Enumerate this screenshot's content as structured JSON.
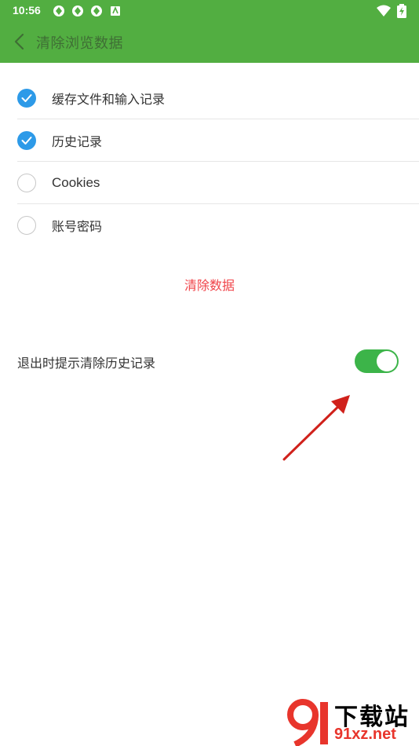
{
  "status_bar": {
    "time": "10:56"
  },
  "header": {
    "title": "清除浏览数据",
    "back_icon": "chevron-left-icon"
  },
  "options": [
    {
      "label": "缓存文件和输入记录",
      "checked": true
    },
    {
      "label": "历史记录",
      "checked": true
    },
    {
      "label": "Cookies",
      "checked": false
    },
    {
      "label": "账号密码",
      "checked": false
    }
  ],
  "clear_button": {
    "label": "清除数据"
  },
  "setting": {
    "label": "退出时提示清除历史记录",
    "enabled": true
  },
  "watermark": {
    "top_text": "下载站",
    "bottom_text": "91xz.net"
  },
  "colors": {
    "header_bg": "#52ae41",
    "checkbox_on": "#2d9ae8",
    "clear_text": "#f0444a",
    "toggle_on": "#3cb449",
    "annotation_arrow": "#d0211b"
  }
}
